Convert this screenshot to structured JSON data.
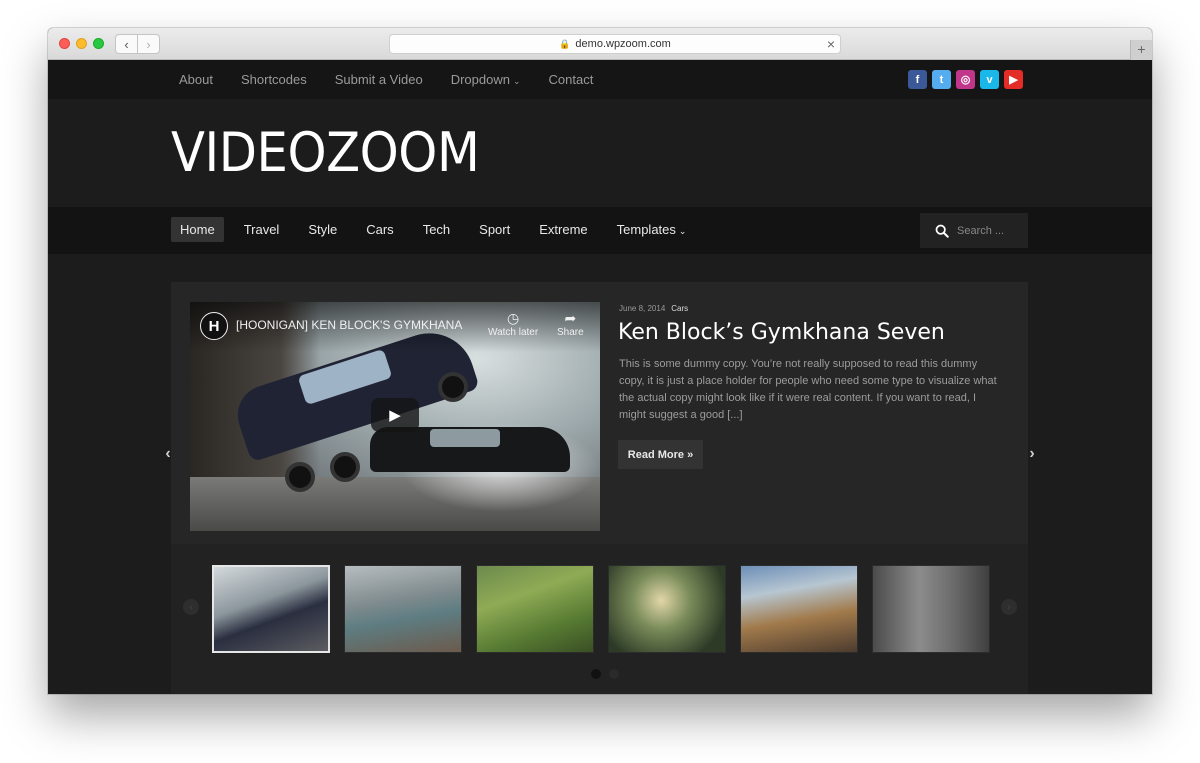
{
  "browser": {
    "url": "demo.wpzoom.com"
  },
  "topbar": {
    "links": [
      "About",
      "Shortcodes",
      "Submit a Video",
      "Dropdown",
      "Contact"
    ],
    "social": [
      "facebook-icon",
      "twitter-icon",
      "instagram-icon",
      "vimeo-icon",
      "youtube-icon"
    ]
  },
  "header": {
    "logo": "VIDEOZOOM"
  },
  "mainnav": {
    "items": [
      "Home",
      "Travel",
      "Style",
      "Cars",
      "Tech",
      "Sport",
      "Extreme",
      "Templates"
    ],
    "active": "Home",
    "search_placeholder": "Search ..."
  },
  "featured": {
    "video_title": "[HOONIGAN] KEN BLOCK'S GYMKHANA",
    "video_channel_logo": "H",
    "watch_later": "Watch later",
    "share": "Share",
    "date": "June 8, 2014",
    "category": "Cars",
    "title": "Ken Block’s Gymkhana Seven",
    "excerpt": "This is some dummy copy. You’re not really supposed to read this dummy copy, it is just a place holder for people who need some type to visualize what the actual copy might look like if it were real content. If you want to read, I might suggest a good [...]",
    "read_more": "Read More »"
  },
  "carousel": {
    "thumbnail_count": 6,
    "active_index": 0,
    "dot_count": 2,
    "active_dot": 0
  },
  "colors": {
    "background": "#1c1c1c",
    "topbar": "#151515",
    "accent_active": "#333333"
  }
}
